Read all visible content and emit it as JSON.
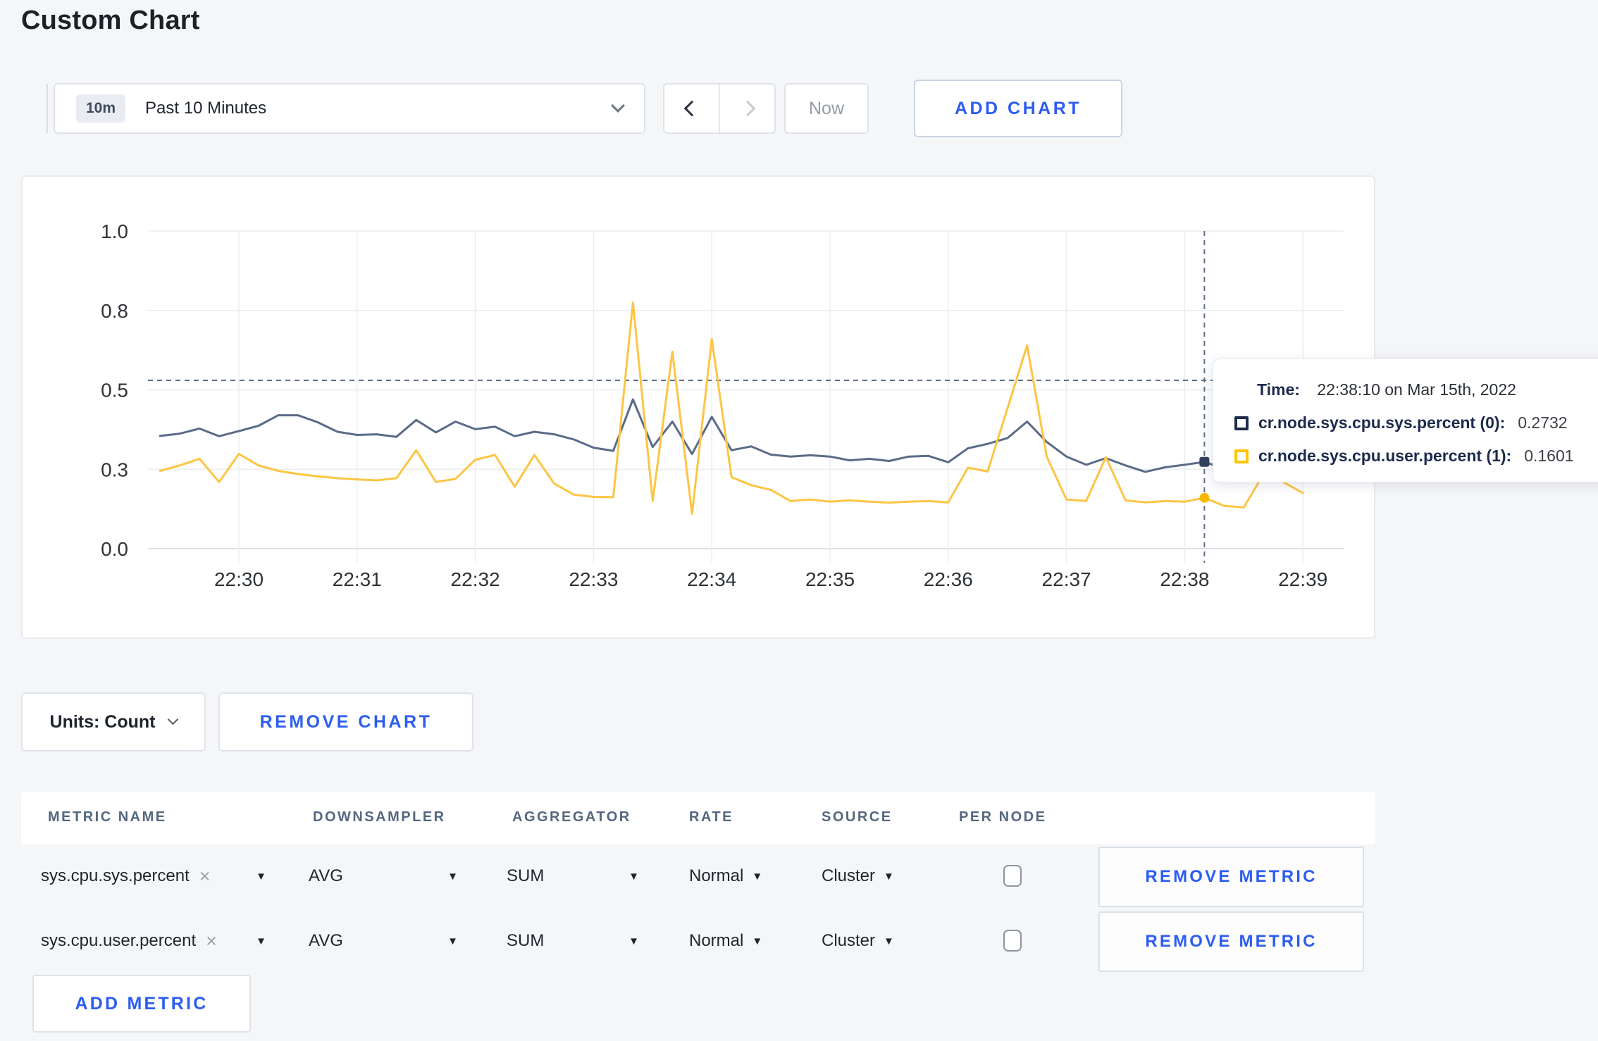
{
  "page": {
    "title": "Custom Chart",
    "background": "#f5f6f8",
    "accent_blue": "#2c5cf2"
  },
  "toolbar": {
    "time_range": {
      "badge": "10m",
      "label": "Past 10 Minutes"
    },
    "now_label": "Now",
    "add_chart_label": "ADD CHART"
  },
  "chart_data": {
    "type": "line",
    "title": "",
    "xlabel": "",
    "ylabel": "",
    "ylim": [
      0,
      1
    ],
    "grid": true,
    "legend": "none",
    "x_start": "22:29:20",
    "x_step_seconds": 10,
    "x_tick_labels": [
      "22:30",
      "22:31",
      "22:32",
      "22:33",
      "22:34",
      "22:35",
      "22:36",
      "22:37",
      "22:38",
      "22:39"
    ],
    "y_tick_labels": [
      "0.0",
      "0.3",
      "0.5",
      "0.8",
      "1.0"
    ],
    "y_tick_values": [
      0,
      0.25,
      0.5,
      0.75,
      1.0
    ],
    "series": [
      {
        "name": "cr.node.sys.cpu.sys.percent",
        "color": "#5b6b87",
        "values": [
          0.355,
          0.362,
          0.378,
          0.354,
          0.37,
          0.387,
          0.42,
          0.42,
          0.398,
          0.368,
          0.358,
          0.36,
          0.352,
          0.405,
          0.366,
          0.4,
          0.376,
          0.384,
          0.354,
          0.368,
          0.36,
          0.344,
          0.318,
          0.308,
          0.47,
          0.32,
          0.4,
          0.298,
          0.415,
          0.31,
          0.322,
          0.296,
          0.29,
          0.294,
          0.29,
          0.278,
          0.283,
          0.276,
          0.29,
          0.292,
          0.272,
          0.316,
          0.33,
          0.348,
          0.4,
          0.336,
          0.29,
          0.264,
          0.285,
          0.262,
          0.242,
          0.256,
          0.264,
          0.2732,
          0.252,
          0.258,
          0.27,
          0.262,
          0.268
        ]
      },
      {
        "name": "cr.node.sys.cpu.user.percent",
        "color": "#fdc543",
        "values": [
          0.245,
          0.262,
          0.283,
          0.21,
          0.298,
          0.262,
          0.245,
          0.235,
          0.228,
          0.222,
          0.218,
          0.215,
          0.222,
          0.31,
          0.21,
          0.22,
          0.28,
          0.295,
          0.195,
          0.295,
          0.205,
          0.17,
          0.163,
          0.162,
          0.775,
          0.15,
          0.62,
          0.11,
          0.66,
          0.225,
          0.2,
          0.185,
          0.15,
          0.155,
          0.148,
          0.152,
          0.148,
          0.145,
          0.148,
          0.15,
          0.146,
          0.255,
          0.243,
          0.44,
          0.64,
          0.29,
          0.155,
          0.15,
          0.288,
          0.152,
          0.146,
          0.15,
          0.148,
          0.1601,
          0.135,
          0.13,
          0.235,
          0.21,
          0.175
        ]
      }
    ],
    "hover": {
      "index": 53,
      "time": "22:38:10",
      "crosshair_y_value": 0.53,
      "values": [
        0.2732,
        0.1601
      ],
      "dot_colors": [
        "#32415f",
        "#f5b800"
      ],
      "crosshair_color": "#5f7089"
    }
  },
  "tooltip": {
    "time_label_prefix": "Time:",
    "time_value": "22:38:10 on Mar 15th, 2022",
    "rows": [
      {
        "label": "cr.node.sys.cpu.sys.percent (0):",
        "value": "0.2732",
        "swatch_color": "#1e2c49"
      },
      {
        "label": "cr.node.sys.cpu.user.percent (1):",
        "value": "0.1601",
        "swatch_color": "#ffc400"
      }
    ]
  },
  "controls": {
    "units_label": "Units: Count",
    "remove_chart_label": "REMOVE CHART"
  },
  "metrics_table": {
    "headers": [
      "METRIC NAME",
      "DOWNSAMPLER",
      "AGGREGATOR",
      "RATE",
      "SOURCE",
      "PER NODE"
    ],
    "remove_metric_label": "REMOVE METRIC",
    "add_metric_label": "ADD METRIC",
    "rows": [
      {
        "metric": "sys.cpu.sys.percent",
        "remove_symbol": "×",
        "downsampler": "AVG",
        "aggregator": "SUM",
        "rate": "Normal",
        "source": "Cluster",
        "per_node_checked": false
      },
      {
        "metric": "sys.cpu.user.percent",
        "remove_symbol": "×",
        "downsampler": "AVG",
        "aggregator": "SUM",
        "rate": "Normal",
        "source": "Cluster",
        "per_node_checked": false
      }
    ]
  }
}
